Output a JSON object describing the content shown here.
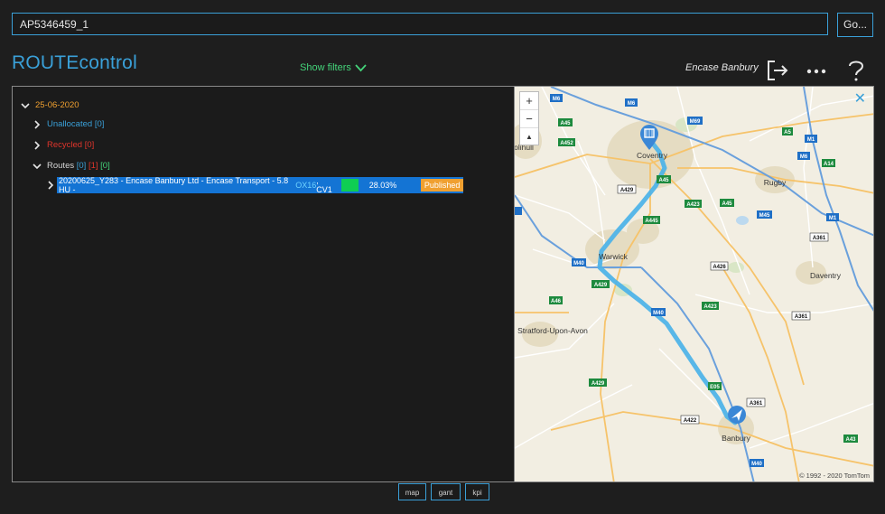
{
  "search": {
    "value": "AP5346459_1",
    "go_label": "Go..."
  },
  "header": {
    "brand": "ROUTEcontrol",
    "show_filters": "Show filters",
    "user": "Encase Banbury"
  },
  "tree": {
    "date": "25-06-2020",
    "unallocated": {
      "label": "Unallocated",
      "count": "[0]"
    },
    "recycled": {
      "label": "Recycled",
      "count": "[0]"
    },
    "routes": {
      "label": "Routes",
      "c1": "[0]",
      "c2": "[1]",
      "c3": "[0]"
    },
    "route_item": {
      "text": "20200625_Y283 - Encase Banbury Ltd - Encase Transport - 5.8 HU - ",
      "postcode_1": "OX16",
      "postcode_2": ", CV1",
      "percent": "28.03%",
      "status": "Published"
    }
  },
  "map": {
    "zoom_in": "+",
    "zoom_out": "−",
    "compass": "▲",
    "close": "✕",
    "copyright": "© 1992 - 2020 TomTom",
    "places": {
      "coventry": "Coventry",
      "warwick": "Warwick",
      "rugby": "Rugby",
      "daventry": "Daventry",
      "stratford": "Stratford-Upon-Avon",
      "banbury": "Banbury",
      "solihull": "olihull"
    },
    "roads": {
      "m6a": "M6",
      "m6b": "M6",
      "m6c": "M6",
      "m69": "M69",
      "m1a": "M1",
      "m1b": "M1",
      "a45a": "A45",
      "a45b": "A45",
      "a45c": "A45",
      "a452": "A452",
      "a5": "A5",
      "a14": "A14",
      "a429a": "A429",
      "a423a": "A423",
      "a423b": "A423",
      "a445": "A445",
      "m45": "M45",
      "a361a": "A361",
      "a361b": "A361",
      "a361c": "A361",
      "m40a": "M40",
      "m40b": "M40",
      "m40c": "M40",
      "a429b": "A429",
      "a429c": "A429",
      "a426": "A426",
      "a46": "A46",
      "e05": "E05",
      "a422": "A422",
      "a43": "A43",
      "m40d": "M40"
    }
  },
  "bottom": {
    "map": "map",
    "gant": "gant",
    "kpi": "kpi"
  },
  "colors": {
    "accent": "#3aa0d8",
    "route": "#4fb3e8",
    "published": "#f0a030",
    "status_ok": "#0fce52"
  }
}
